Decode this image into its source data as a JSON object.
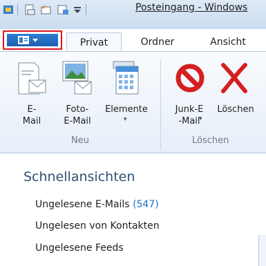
{
  "titlebar": {
    "title": "Posteingang - Windows"
  },
  "tabs": [
    {
      "label": "Privat"
    },
    {
      "label": "Ordner"
    },
    {
      "label": "Ansicht"
    }
  ],
  "ribbon": {
    "buttons": {
      "email": "E-\nMail",
      "photo_email": "Foto-\nE-Mail",
      "elements": "Elemente",
      "junk": "Junk-E\n-Mail",
      "delete": "Löschen"
    },
    "groups": {
      "new": "Neu",
      "delete": "Löschen"
    }
  },
  "nav": {
    "heading": "Schnellansichten",
    "items": [
      {
        "label": "Ungelesene E-Mails",
        "count": "(547)"
      },
      {
        "label": "Ungelesen von Kontakten",
        "count": ""
      },
      {
        "label": "Ungelesene Feeds",
        "count": ""
      }
    ]
  },
  "colors": {
    "accent": "#1f6fd1",
    "highlight_border": "#e0141e",
    "delete_red": "#d42020"
  }
}
